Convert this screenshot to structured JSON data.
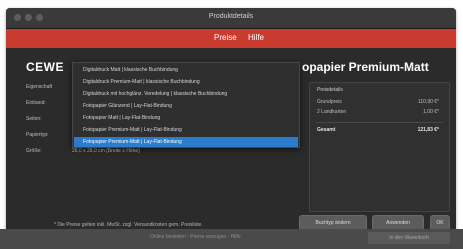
{
  "window": {
    "title": "Produktdetails"
  },
  "menu": {
    "items": [
      "Preise",
      "Hilfe"
    ]
  },
  "brand": "CEWE",
  "product_title": "opapier Premium-Matt",
  "properties": {
    "labels": [
      "Eigenschaft",
      "Einband:",
      "Seiten:",
      "Papiertyp:",
      "Größe:"
    ],
    "size_value": "28,0 x 28,0 cm (Breite x Höhe)"
  },
  "paper_options": [
    "Digitaldruck Matt | klassische Buchbindung",
    "Digitaldruck Premium-Matt | klassische Buchbindung",
    "Digitaldruck mit hochglänz. Veredelung | klassische Buchbindung",
    "Fotopapier Glänzend | Lay-Flat-Bindung",
    "Fotopapier Matt | Lay-Flat-Bindung",
    "Fotopapier Premium-Matt | Lay-Flat-Bindung",
    "Fotopapier Premium-Matt | Lay-Flat-Bindung"
  ],
  "price_panel": {
    "header": "Preisdetails",
    "lines": [
      {
        "label": "Grundpreis",
        "value": "110,90 €*"
      },
      {
        "label": "2 Landkarten",
        "value": "1,00 €*"
      }
    ],
    "total": {
      "label": "Gesamt",
      "value": "121,83 €*"
    }
  },
  "footnote": "* Die Preise gelten inkl. MwSt. zzgl. Versandkosten gem. Preisliste.",
  "buttons": {
    "b1": "Buchtyp ändern",
    "b2": "Anwenden",
    "b3": "OK"
  },
  "bottom_bar": {
    "faded_text": "Online bestellen · Preise anzeigen · Hilfe",
    "button": "In den Warenkorb"
  }
}
